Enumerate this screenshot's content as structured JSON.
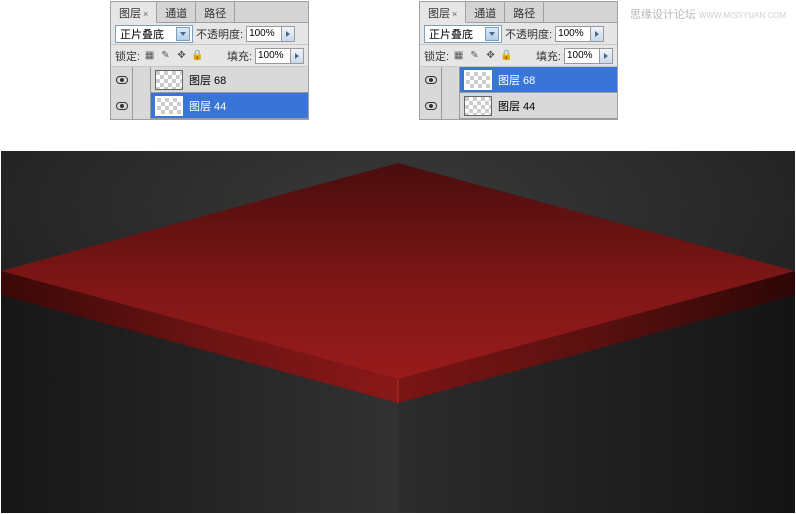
{
  "tabs": {
    "layers": "图层",
    "channels": "通道",
    "paths": "路径"
  },
  "close_glyph": "×",
  "blend_mode": "正片叠底",
  "opacity_label": "不透明度:",
  "opacity_value": "100%",
  "lock_label": "锁定:",
  "fill_label": "填充:",
  "fill_value": "100%",
  "lock_icons": {
    "pixels": "▦",
    "brush": "✎",
    "move": "✥",
    "all": "🔒"
  },
  "panels": {
    "left": {
      "layers": [
        {
          "name": "图层 68",
          "selected": false
        },
        {
          "name": "图层 44",
          "selected": true
        }
      ]
    },
    "right": {
      "layers": [
        {
          "name": "图层 68",
          "selected": true
        },
        {
          "name": "图层 44",
          "selected": false
        }
      ]
    }
  },
  "watermark": {
    "main": "思缘设计论坛",
    "sub": "WWW.MISSYUAN.COM"
  }
}
